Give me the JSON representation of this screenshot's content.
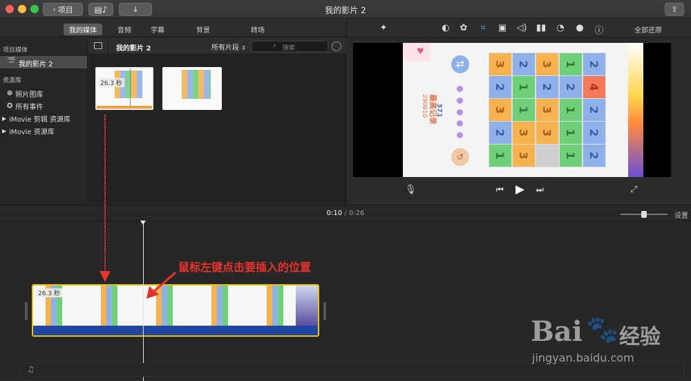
{
  "window": {
    "title": "我的影片 2",
    "back_label": "项目"
  },
  "toolbar": {
    "tabs": [
      {
        "label": "我的媒体"
      },
      {
        "label": "音频"
      },
      {
        "label": "字幕"
      },
      {
        "label": "背景"
      },
      {
        "label": "转场"
      }
    ],
    "reset_all_label": "全部还原",
    "icons": [
      "magic-wand-icon",
      "color-balance-icon",
      "color-palette-icon",
      "crop-icon",
      "camera-icon",
      "volume-icon",
      "equalizer-icon",
      "speed-icon",
      "filter-icon",
      "info-icon"
    ]
  },
  "sidebar": {
    "section_project": "项目媒体",
    "project_item": "我的影片 2",
    "section_library": "资源库",
    "items": [
      {
        "label": "照片图库"
      },
      {
        "label": "所有事件"
      },
      {
        "label": "iMovie 剪辑 资源库"
      },
      {
        "label": "iMovie 资源库"
      }
    ]
  },
  "browser": {
    "title": "我的影片 2",
    "filter": "所有片段",
    "search_placeholder": "搜索",
    "clip1_duration": "26.3 秒"
  },
  "game": {
    "record_label": "最高记录",
    "record_value": "290810",
    "score_value": "371",
    "grid": [
      [
        "3",
        "2",
        "3",
        "1",
        "2"
      ],
      [
        "2",
        "1",
        "2",
        "2",
        "4"
      ],
      [
        "3",
        "1",
        "3",
        "1",
        "2"
      ],
      [
        "2",
        "3",
        "3",
        "1",
        "2"
      ],
      [
        "1",
        "3",
        "",
        "1",
        "2"
      ]
    ]
  },
  "timeline": {
    "current": "0:10",
    "separator": "/",
    "total": "0:26",
    "settings_label": "设置",
    "clip_duration": "26.3 秒"
  },
  "annotation": {
    "text": "鼠标左键点击要插入的位置"
  },
  "watermark": {
    "brand": "Bai",
    "brand2": "经验",
    "url": "jingyan.baidu.com"
  },
  "colors": {
    "orange": "#f6b24e",
    "blue": "#8fb1ea",
    "green": "#6fd07a",
    "gray": "#cfcfcf",
    "red": "#f07a5a",
    "accent_yellow": "#f2c300",
    "annotation_red": "#e8322b"
  }
}
